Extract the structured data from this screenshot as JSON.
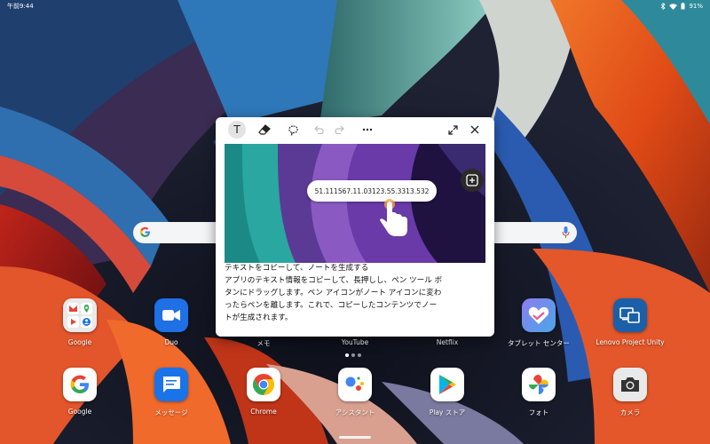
{
  "status_bar": {
    "time": "午前9:44",
    "battery": "91%",
    "icons": [
      "bluetooth-icon",
      "wifi-icon",
      "battery-icon"
    ]
  },
  "search_bar": {
    "logo": "google-g-icon",
    "mic": "mic-icon"
  },
  "home_row": [
    {
      "label": "Google",
      "icon": "google-folder"
    },
    {
      "label": "Duo",
      "icon": "duo-camera"
    },
    {
      "label": "メモ",
      "icon": "memo"
    },
    {
      "label": "YouTube",
      "icon": "youtube"
    },
    {
      "label": "Netflix",
      "icon": "netflix"
    },
    {
      "label": "タブレット センター",
      "icon": "tablet-center"
    },
    {
      "label": "Lenovo Project Unity",
      "icon": "project-unity"
    }
  ],
  "dock": [
    {
      "label": "Google",
      "icon": "google-g"
    },
    {
      "label": "メッセージ",
      "icon": "messages"
    },
    {
      "label": "Chrome",
      "icon": "chrome"
    },
    {
      "label": "アシスタント",
      "icon": "assistant"
    },
    {
      "label": "Play ストア",
      "icon": "play-store"
    },
    {
      "label": "フォト",
      "icon": "photos"
    },
    {
      "label": "カメラ",
      "icon": "camera"
    }
  ],
  "note_window": {
    "toolbar": {
      "text_tool": "T",
      "tools": [
        "text-tool",
        "eraser-icon",
        "lasso-icon",
        "undo-icon",
        "redo-icon",
        "more-icon",
        "expand-icon",
        "close-icon"
      ]
    },
    "image": {
      "copied_text": "51.111567.11.03123.55.3313.532"
    },
    "body_lines": [
      "テキストをコピーして、ノートを生成する",
      "アプリのテキスト情報をコピーして、長押しし、ペン ツール ボ",
      "タンにドラッグします。ペン アイコンがノート アイコンに変わ",
      "ったらペンを離します。これで、コピーしたコンテンツでノー",
      "トが生成されます。"
    ]
  },
  "colors": {
    "duo": "#1f6fe5",
    "messages": "#1a73e8",
    "tablet_center": "#6a74e8",
    "project_unity": "#1b5fa8"
  }
}
